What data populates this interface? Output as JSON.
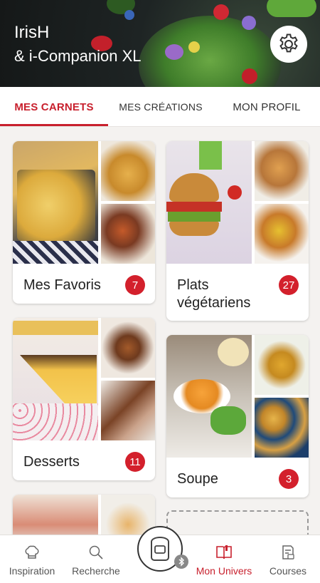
{
  "header": {
    "user_name": "IrisH",
    "device_name": "& i-Companion XL"
  },
  "tabs": [
    {
      "label": "MES CARNETS",
      "active": true
    },
    {
      "label": "MES CRÉATIONS",
      "active": false
    },
    {
      "label": "MON PROFIL",
      "active": false
    }
  ],
  "notebooks": [
    {
      "title": "Mes Favoris",
      "count": "7"
    },
    {
      "title": "Plats végétariens",
      "count": "27"
    },
    {
      "title": "Desserts",
      "count": "11"
    },
    {
      "title": "Soupe",
      "count": "3"
    }
  ],
  "bottom_nav": [
    {
      "label": "Inspiration",
      "icon": "chef-hat-icon",
      "active": false
    },
    {
      "label": "Recherche",
      "icon": "search-icon",
      "active": false
    },
    {
      "label": "Mon Univers",
      "icon": "open-book-icon",
      "active": true
    },
    {
      "label": "Courses",
      "icon": "shopping-list-icon",
      "active": false
    }
  ],
  "colors": {
    "accent": "#c8202d",
    "badge": "#d3202c"
  }
}
